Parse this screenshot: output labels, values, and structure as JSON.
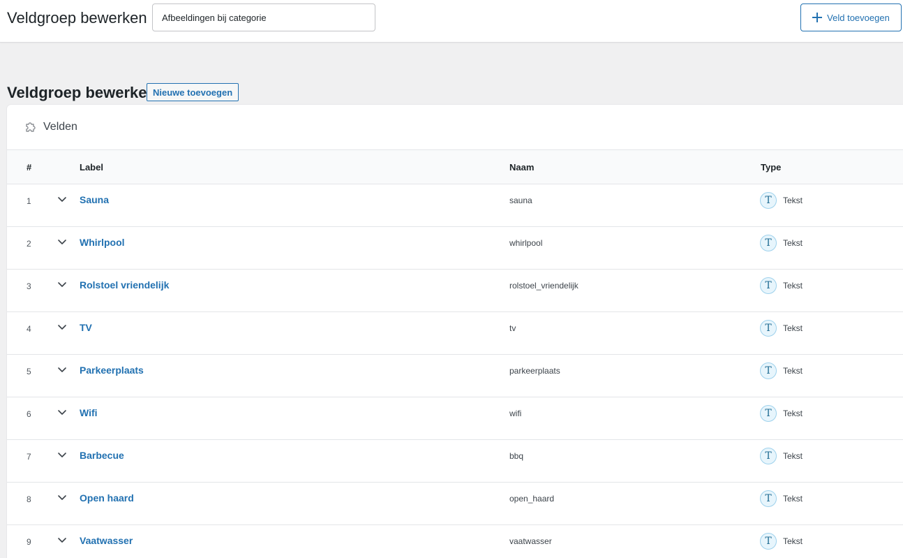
{
  "topbar": {
    "title": "Veldgroep bewerken",
    "group_title_value": "Afbeeldingen bij categorie",
    "add_field_label": "Veld toevoegen"
  },
  "page": {
    "heading": "Veldgroep bewerken",
    "add_new_label": "Nieuwe toevoegen"
  },
  "panel": {
    "title": "Velden",
    "columns": {
      "num": "#",
      "label": "Label",
      "name": "Naam",
      "type": "Type"
    },
    "type_icon_glyph": "T",
    "rows": [
      {
        "num": "1",
        "label": "Sauna",
        "name": "sauna",
        "type": "Tekst"
      },
      {
        "num": "2",
        "label": "Whirlpool",
        "name": "whirlpool",
        "type": "Tekst"
      },
      {
        "num": "3",
        "label": "Rolstoel vriendelijk",
        "name": "rolstoel_vriendelijk",
        "type": "Tekst"
      },
      {
        "num": "4",
        "label": "TV",
        "name": "tv",
        "type": "Tekst"
      },
      {
        "num": "5",
        "label": "Parkeerplaats",
        "name": "parkeerplaats",
        "type": "Tekst"
      },
      {
        "num": "6",
        "label": "Wifi",
        "name": "wifi",
        "type": "Tekst"
      },
      {
        "num": "7",
        "label": "Barbecue",
        "name": "bbq",
        "type": "Tekst"
      },
      {
        "num": "8",
        "label": "Open haard",
        "name": "open_haard",
        "type": "Tekst"
      },
      {
        "num": "9",
        "label": "Vaatwasser",
        "name": "vaatwasser",
        "type": "Tekst"
      }
    ]
  },
  "colors": {
    "accent": "#2271b1",
    "background": "#f0f0f1",
    "type_icon_bg": "#e7f5fc"
  }
}
